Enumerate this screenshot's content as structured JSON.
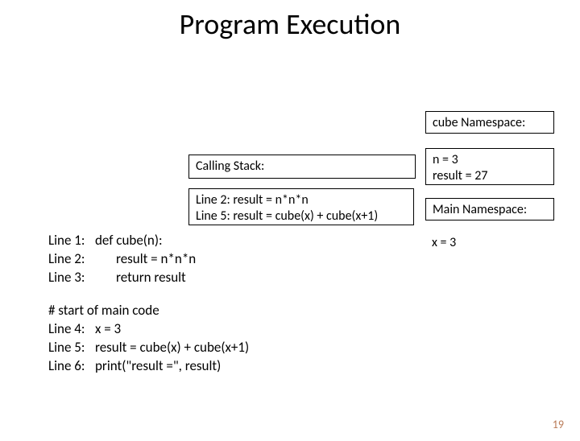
{
  "title": "Program Execution",
  "cube_ns_label": "cube Namespace:",
  "cube_ns": {
    "n": "n = 3",
    "result": "result = 27"
  },
  "calling_label": "Calling Stack:",
  "calling": {
    "l2": "Line 2: result = n*n*n",
    "l5": "Line 5: result = cube(x) + cube(x+1)"
  },
  "main_ns_label": "Main Namespace:",
  "main_ns": {
    "x": "x = 3"
  },
  "code": {
    "l1": {
      "ln": "Line 1:",
      "txt": "def cube(n):"
    },
    "l2": {
      "ln": "Line 2:",
      "txt": "result = n*n*n"
    },
    "l3": {
      "ln": "Line 3:",
      "txt": "return result"
    },
    "comment": "# start of main code",
    "l4": {
      "ln": "Line 4:",
      "txt": "x = 3"
    },
    "l5": {
      "ln": "Line 5:",
      "txt": "result = cube(x) + cube(x+1)"
    },
    "l6": {
      "ln": "Line 6:",
      "txt": "print(\"result =\", result)"
    }
  },
  "slide_number": "19"
}
